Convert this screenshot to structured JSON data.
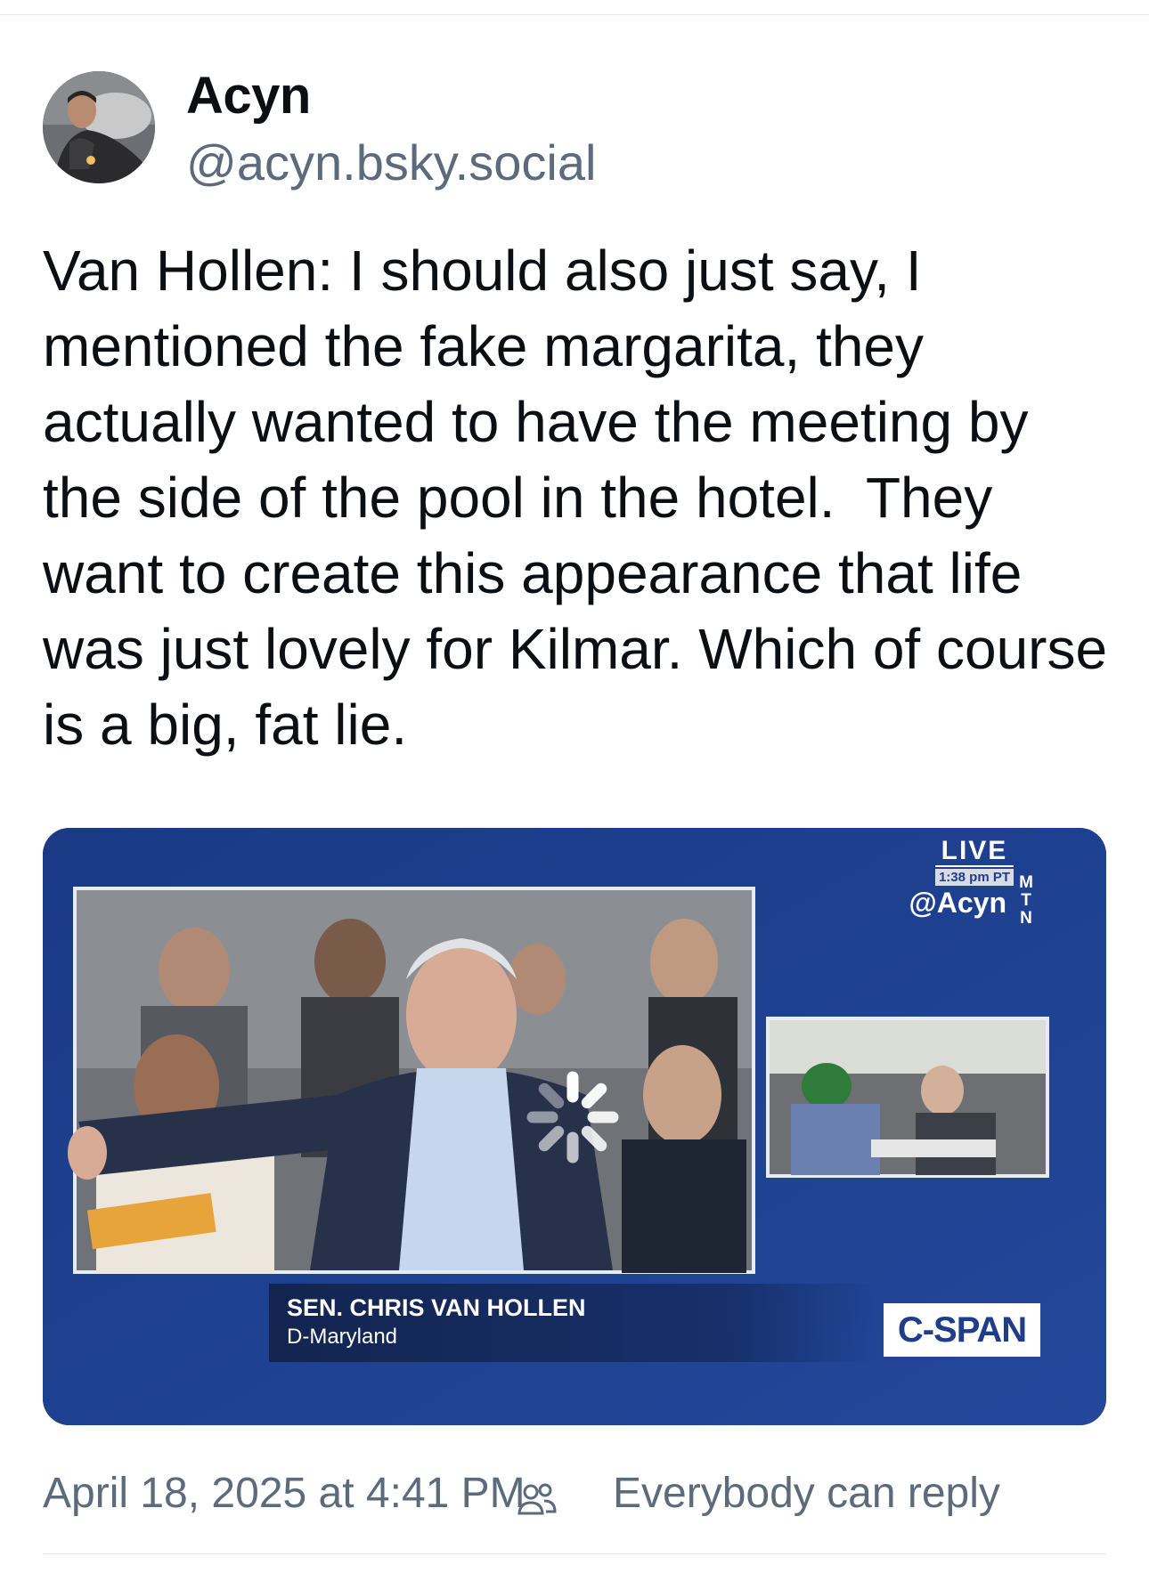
{
  "author": {
    "display_name": "Acyn",
    "handle": "@acyn.bsky.social",
    "avatar_icon": "profile-photo"
  },
  "post": {
    "text": "Van Hollen: I should also just say, I mentioned the fake margarita, they actually wanted to have the meeting by the side of the pool in the hotel.  They want to create this appearance that life was just lovely for Kilmar. Which of course is a big, fat lie."
  },
  "video": {
    "live_label": "LIVE",
    "live_time": "1:38 pm PT",
    "source_handle": "@Acyn",
    "network_tag": "MTN",
    "lower_third_name": "SEN. CHRIS VAN HOLLEN",
    "lower_third_party": "D-Maryland",
    "network_logo": "C-SPAN",
    "background_color": "#1f3d8a",
    "state": "loading"
  },
  "footer": {
    "timestamp": "April 18, 2025 at 4:41 PM",
    "reply_setting": "Everybody can reply",
    "reply_icon": "people-icon"
  }
}
